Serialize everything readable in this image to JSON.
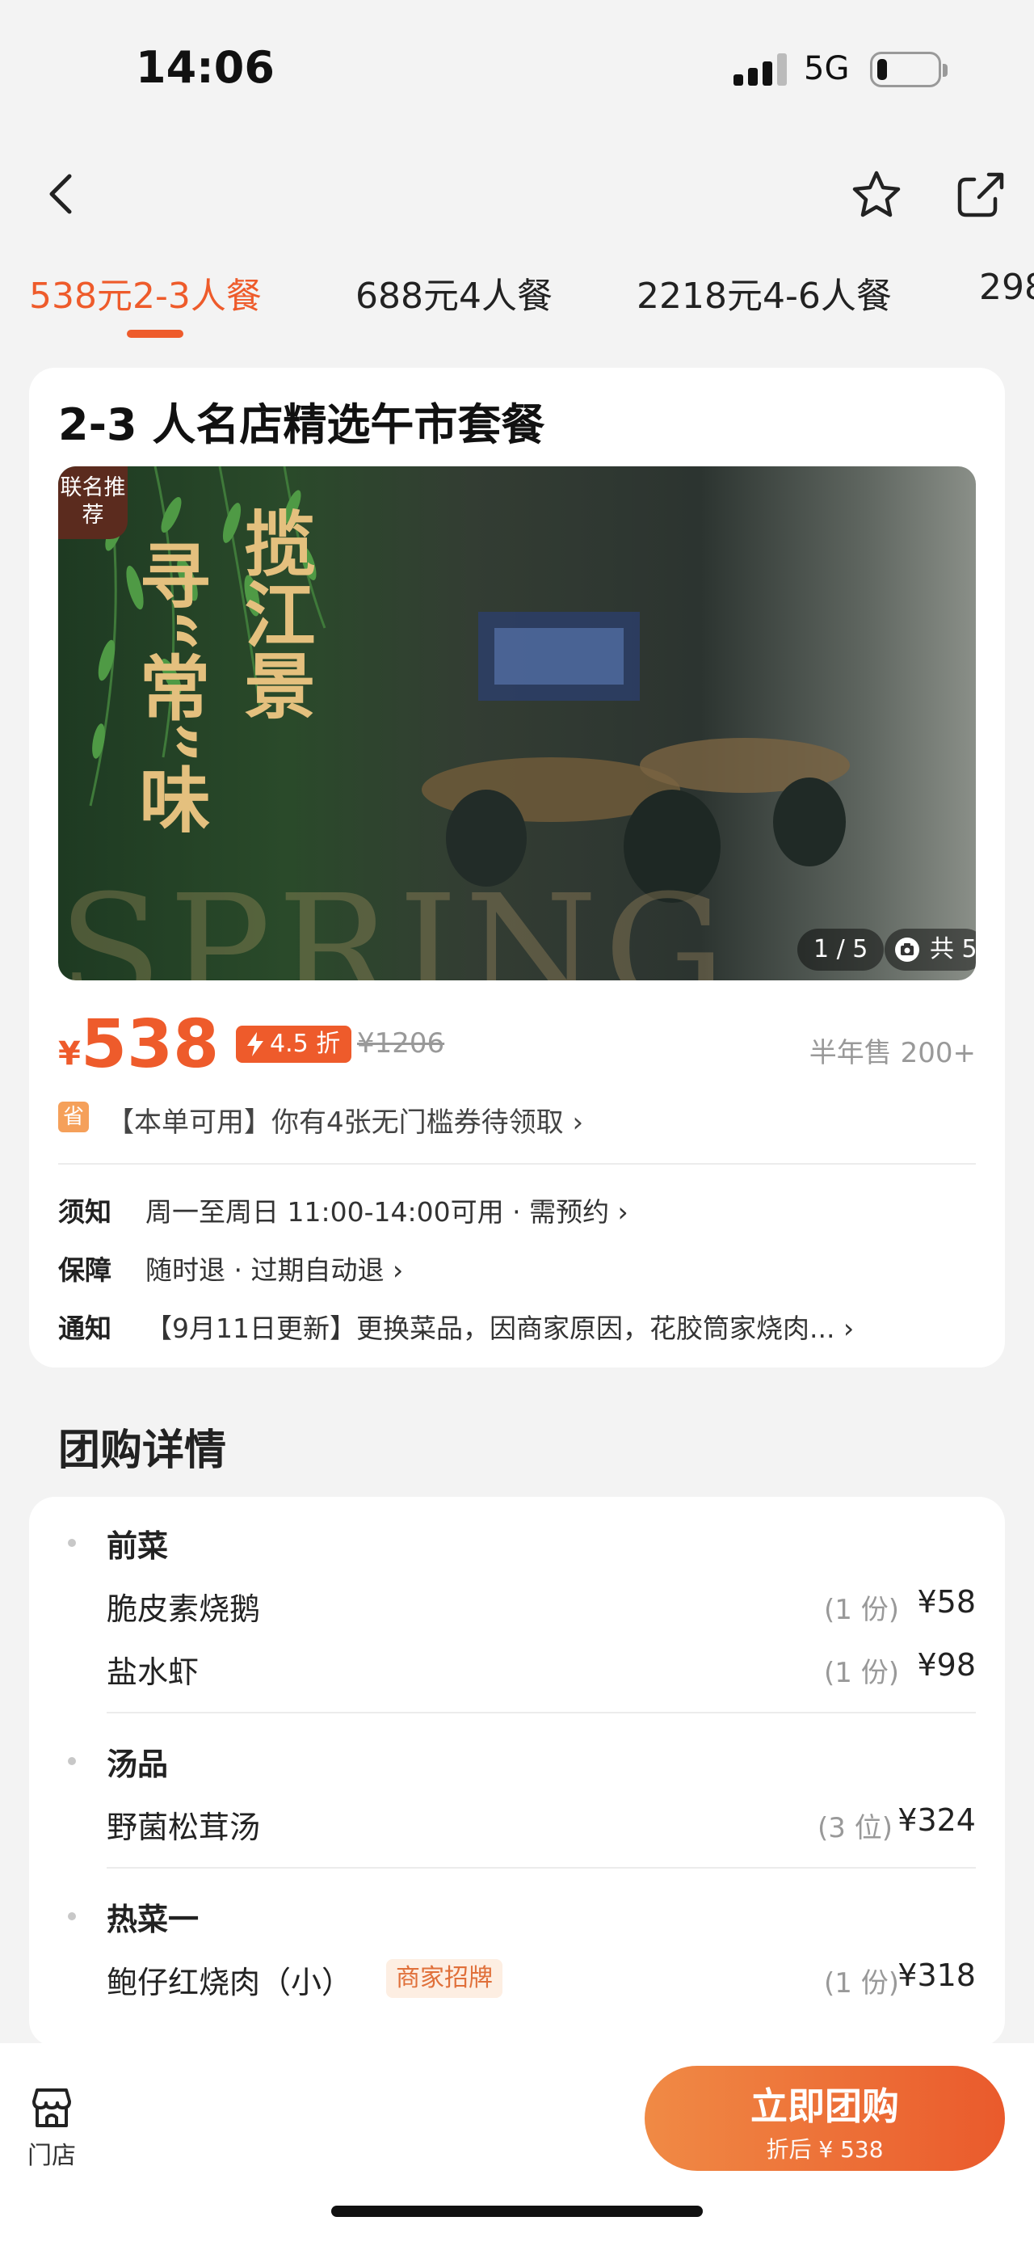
{
  "status": {
    "time": "14:06",
    "network": "5G",
    "battery_pct": 10
  },
  "tabs": [
    "538元2-3人餐",
    "688元4人餐",
    "2218元4-6人餐",
    "298"
  ],
  "deal": {
    "title": "2-3 人名店精选午市套餐",
    "hero": {
      "badge": "联名推荐",
      "slogan_left": "寻“常”味",
      "slogan_right": "揽江景",
      "watermark": "SPRING",
      "pager": "1 / 5",
      "photo_count": "共 5"
    },
    "price_symbol": "¥",
    "price": "538",
    "discount": "4.5 折",
    "original_price": "¥1206",
    "sold": "半年售 200+",
    "coupon_icon": "省",
    "coupon_text": "【本单可用】你有4张无门槛券待领取 ›",
    "info": [
      {
        "key": "须知",
        "value": "周一至周日 11:00-14:00可用 · 需预约 ›"
      },
      {
        "key": "保障",
        "value": "随时退 · 过期自动退 ›"
      },
      {
        "key": "通知",
        "value": "【9月11日更新】更换菜品，因商家原因，花胶筒家烧肉... ›"
      }
    ]
  },
  "details": {
    "section_title": "团购详情",
    "groups": [
      {
        "name": "前菜",
        "dishes": [
          {
            "name": "脆皮素烧鹅",
            "qty": "(1 份)",
            "price": "¥58"
          },
          {
            "name": "盐水虾",
            "qty": "(1 份)",
            "price": "¥98"
          }
        ]
      },
      {
        "name": "汤品",
        "dishes": [
          {
            "name": "野菌松茸汤",
            "qty": "(3 位)",
            "price": "¥324"
          }
        ]
      },
      {
        "name": "热菜一",
        "dishes": [
          {
            "name": "鲍仔红烧肉（小）",
            "tag": "商家招牌",
            "qty": "(1 份)",
            "price": "¥318"
          }
        ]
      }
    ]
  },
  "bottom": {
    "store_label": "门店",
    "buy_label": "立即团购",
    "buy_sub": "折后 ¥ 538"
  },
  "colors": {
    "accent": "#ee5b2b",
    "button_gradient_start": "#f08a45",
    "button_gradient_end": "#ea5a2c"
  },
  "icons": [
    "back-icon",
    "star-icon",
    "share-icon",
    "camera-icon",
    "bolt-icon",
    "store-icon"
  ]
}
